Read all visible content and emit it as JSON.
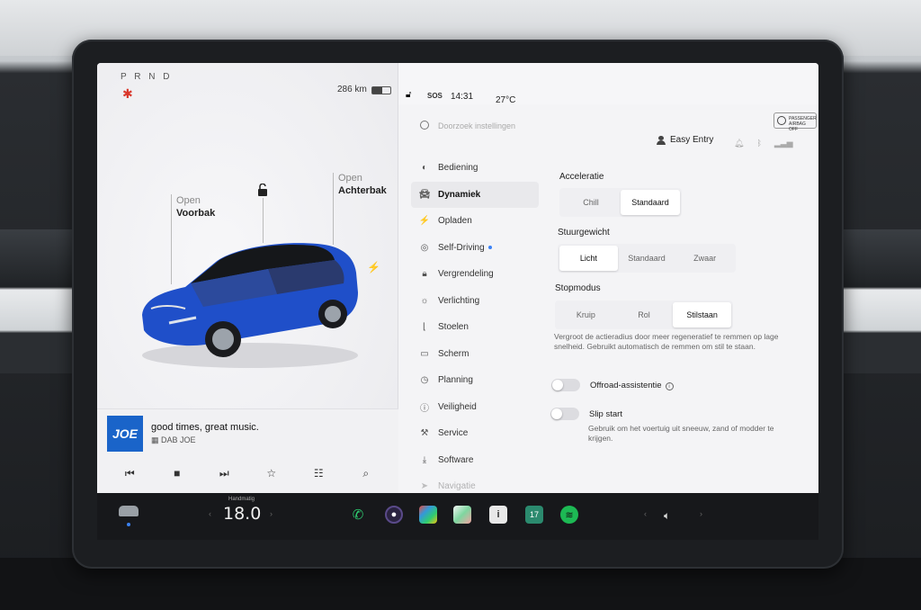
{
  "status": {
    "gear": "P R N D",
    "range": "286 km",
    "sos": "SOS",
    "time": "14:31",
    "temperature": "27°C",
    "battery_level": 0.55
  },
  "car_view": {
    "front_trunk": {
      "state": "Open",
      "name": "Voorbak"
    },
    "rear_trunk": {
      "state": "Open",
      "name": "Achterbak"
    },
    "car_color": "#1f4fc9"
  },
  "media": {
    "logo": "JOE",
    "song": "good times, great music.",
    "station": "DAB JOE"
  },
  "search": {
    "placeholder": "Doorzoek instellingen"
  },
  "airbag": {
    "line1": "PASSENGER",
    "line2": "AIRBAG OFF"
  },
  "profile": {
    "name": "Easy Entry"
  },
  "nav": {
    "items": [
      {
        "label": "Bediening",
        "icon": "toggle-icon"
      },
      {
        "label": "Dynamiek",
        "icon": "car-icon"
      },
      {
        "label": "Opladen",
        "icon": "bolt-icon"
      },
      {
        "label": "Self-Driving",
        "icon": "steering-wheel-icon"
      },
      {
        "label": "Vergrendeling",
        "icon": "lock-icon"
      },
      {
        "label": "Verlichting",
        "icon": "light-icon"
      },
      {
        "label": "Stoelen",
        "icon": "seat-icon"
      },
      {
        "label": "Scherm",
        "icon": "screen-icon"
      },
      {
        "label": "Planning",
        "icon": "clock-icon"
      },
      {
        "label": "Veiligheid",
        "icon": "info-icon"
      },
      {
        "label": "Service",
        "icon": "wrench-icon"
      },
      {
        "label": "Software",
        "icon": "download-icon"
      },
      {
        "label": "Navigatie",
        "icon": "navigation-icon"
      }
    ],
    "active_index": 1
  },
  "settings": {
    "acceleration": {
      "title": "Acceleratie",
      "options": [
        "Chill",
        "Standaard"
      ],
      "selected": "Standaard"
    },
    "steering": {
      "title": "Stuurgewicht",
      "options": [
        "Licht",
        "Standaard",
        "Zwaar"
      ],
      "selected": "Licht"
    },
    "stop_mode": {
      "title": "Stopmodus",
      "options": [
        "Kruip",
        "Rol",
        "Stilstaan"
      ],
      "selected": "Stilstaan",
      "description": "Vergroot de actieradius door meer regeneratief te remmen op lage snelheid. Gebruikt automatisch de remmen om stil te staan."
    },
    "offroad": {
      "label": "Offroad-assistentie",
      "enabled": false
    },
    "slip_start": {
      "label": "Slip start",
      "enabled": false,
      "description": "Gebruik om het voertuig uit sneeuw, zand of modder te krijgen."
    }
  },
  "dock": {
    "climate_mode": "Handmatig",
    "cabin_temp": "18.0",
    "apps": [
      "phone-icon",
      "camera-icon",
      "toybox-icon",
      "maps-icon",
      "manual-icon",
      "calendar-icon",
      "spotify-icon"
    ],
    "colors": {
      "phone": "#2ecc71",
      "spotify": "#1db954"
    }
  }
}
